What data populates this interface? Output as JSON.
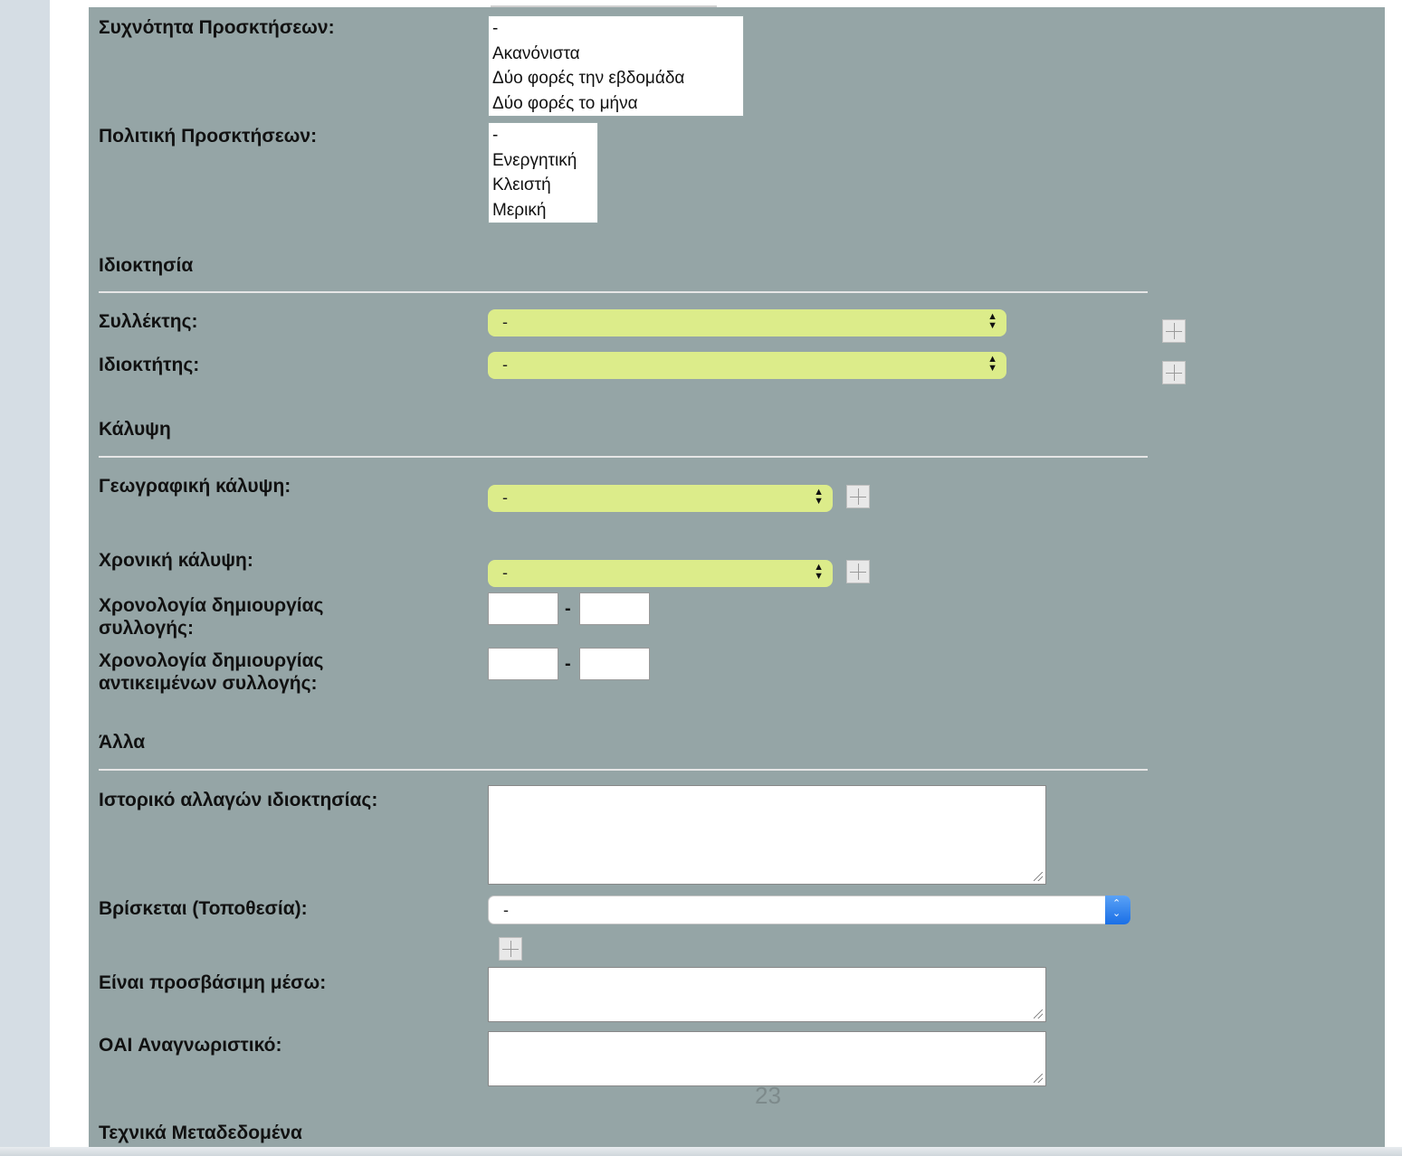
{
  "fields": {
    "frequency_label": "Συχνότητα Προσκτήσεων:",
    "frequency_options": [
      "-",
      "Ακανόνιστα",
      "Δύο φορές την εβδομάδα",
      "Δύο φορές το μήνα"
    ],
    "policy_label": "Πολιτική Προσκτήσεων:",
    "policy_options": [
      "-",
      "Ενεργητική",
      "Κλειστή",
      "Μερική"
    ]
  },
  "ownership": {
    "title": "Ιδιοκτησία",
    "collector_label": "Συλλέκτης:",
    "collector_value": "-",
    "owner_label": "Ιδιοκτήτης:",
    "owner_value": "-"
  },
  "coverage": {
    "title": "Κάλυψη",
    "geo_label": "Γεωγραφική κάλυψη:",
    "geo_value": "-",
    "time_label": "Χρονική κάλυψη:",
    "time_value": "-",
    "creation_label_1": "Χρονολογία δημιουργίας",
    "creation_label_2": "συλλογής:",
    "objects_label_1": "Χρονολογία δημιουργίας",
    "objects_label_2": "αντικειμένων συλλογής:",
    "range_separator": "-"
  },
  "other": {
    "title": "Άλλα",
    "history_label": "Ιστορικό αλλαγών ιδιοκτησίας:",
    "location_label": "Βρίσκεται (Τοποθεσία):",
    "location_value": "-",
    "access_label": "Είναι προσβάσιμη μέσω:",
    "oai_label": "OAI Αναγνωριστικό:"
  },
  "technical": {
    "title": "Τεχνικά Μεταδεδομένα"
  },
  "page_number": "23",
  "colors": {
    "panel": "#95a5a6",
    "select_bg": "#dcec8a",
    "accent": "#1a6fe6"
  }
}
